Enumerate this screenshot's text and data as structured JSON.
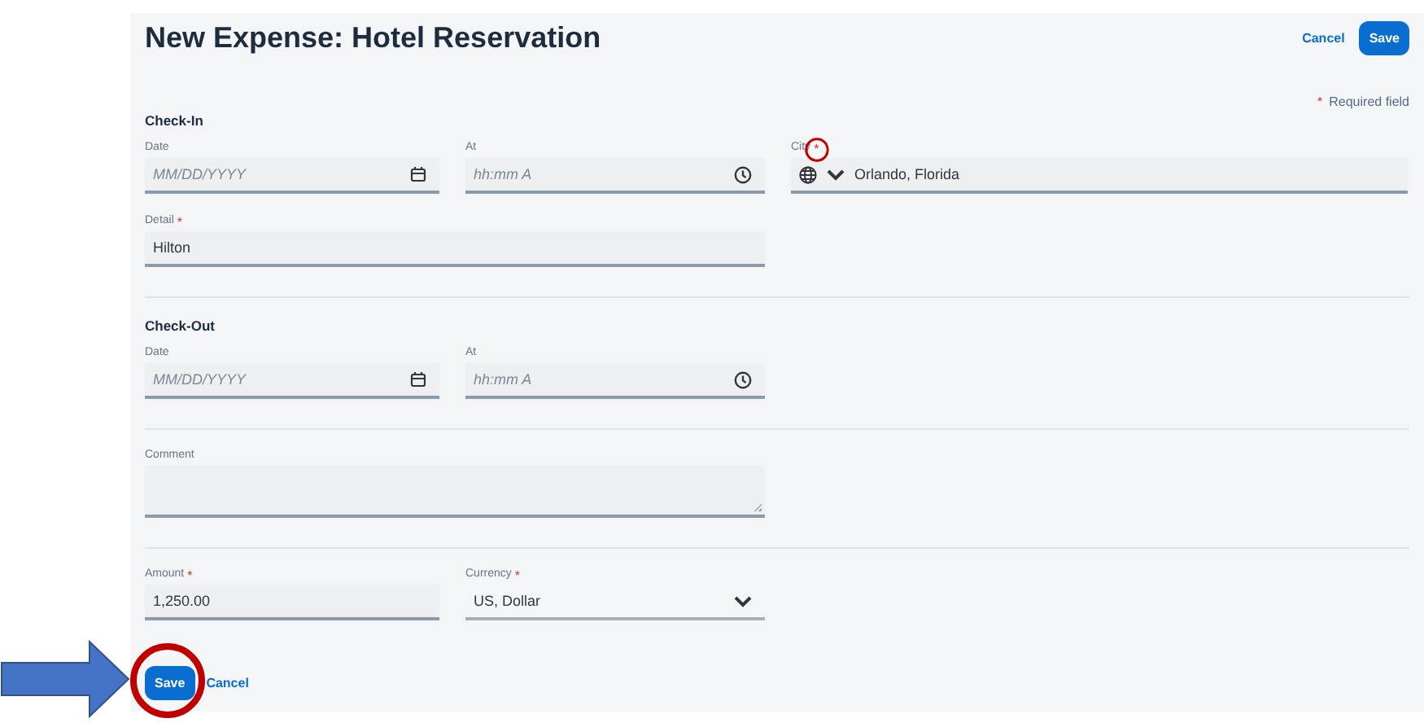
{
  "header": {
    "title": "New Expense: Hotel Reservation",
    "buttons": [
      {
        "label": "Cancel",
        "kind": "link"
      },
      {
        "label": "Save",
        "kind": "primary"
      }
    ]
  },
  "required_note": {
    "mark": "*",
    "text": "Required field"
  },
  "sections": [
    {
      "heading": "Check-In",
      "rows": [
        [
          {
            "label": "Date",
            "kind": "date",
            "placeholder": "MM/DD/YYYY"
          },
          {
            "label": "At",
            "kind": "time",
            "placeholder": "hh:mm A"
          },
          {
            "label": "City",
            "required_mark": "*",
            "kind": "location",
            "value": "Orlando, Florida"
          }
        ],
        [
          {
            "label": "Detail",
            "required_mark": "*",
            "kind": "text",
            "value": "Hilton"
          }
        ]
      ]
    },
    {
      "heading": "Check-Out",
      "rows": [
        [
          {
            "label": "Date",
            "kind": "date",
            "placeholder": "MM/DD/YYYY"
          },
          {
            "label": "At",
            "kind": "time",
            "placeholder": "hh:mm A"
          }
        ]
      ]
    },
    {
      "rows": [
        [
          {
            "label": "Comment",
            "kind": "textarea"
          }
        ]
      ]
    },
    {
      "rows": [
        [
          {
            "label": "Amount",
            "required_mark": "*",
            "kind": "text",
            "value": "1,250.00"
          },
          {
            "label": "Currency",
            "required_mark": "*",
            "kind": "select",
            "value": "US, Dollar"
          }
        ]
      ]
    }
  ],
  "footer_buttons": [
    {
      "label": "Save",
      "kind": "primary"
    },
    {
      "label": "Cancel",
      "kind": "link"
    }
  ]
}
